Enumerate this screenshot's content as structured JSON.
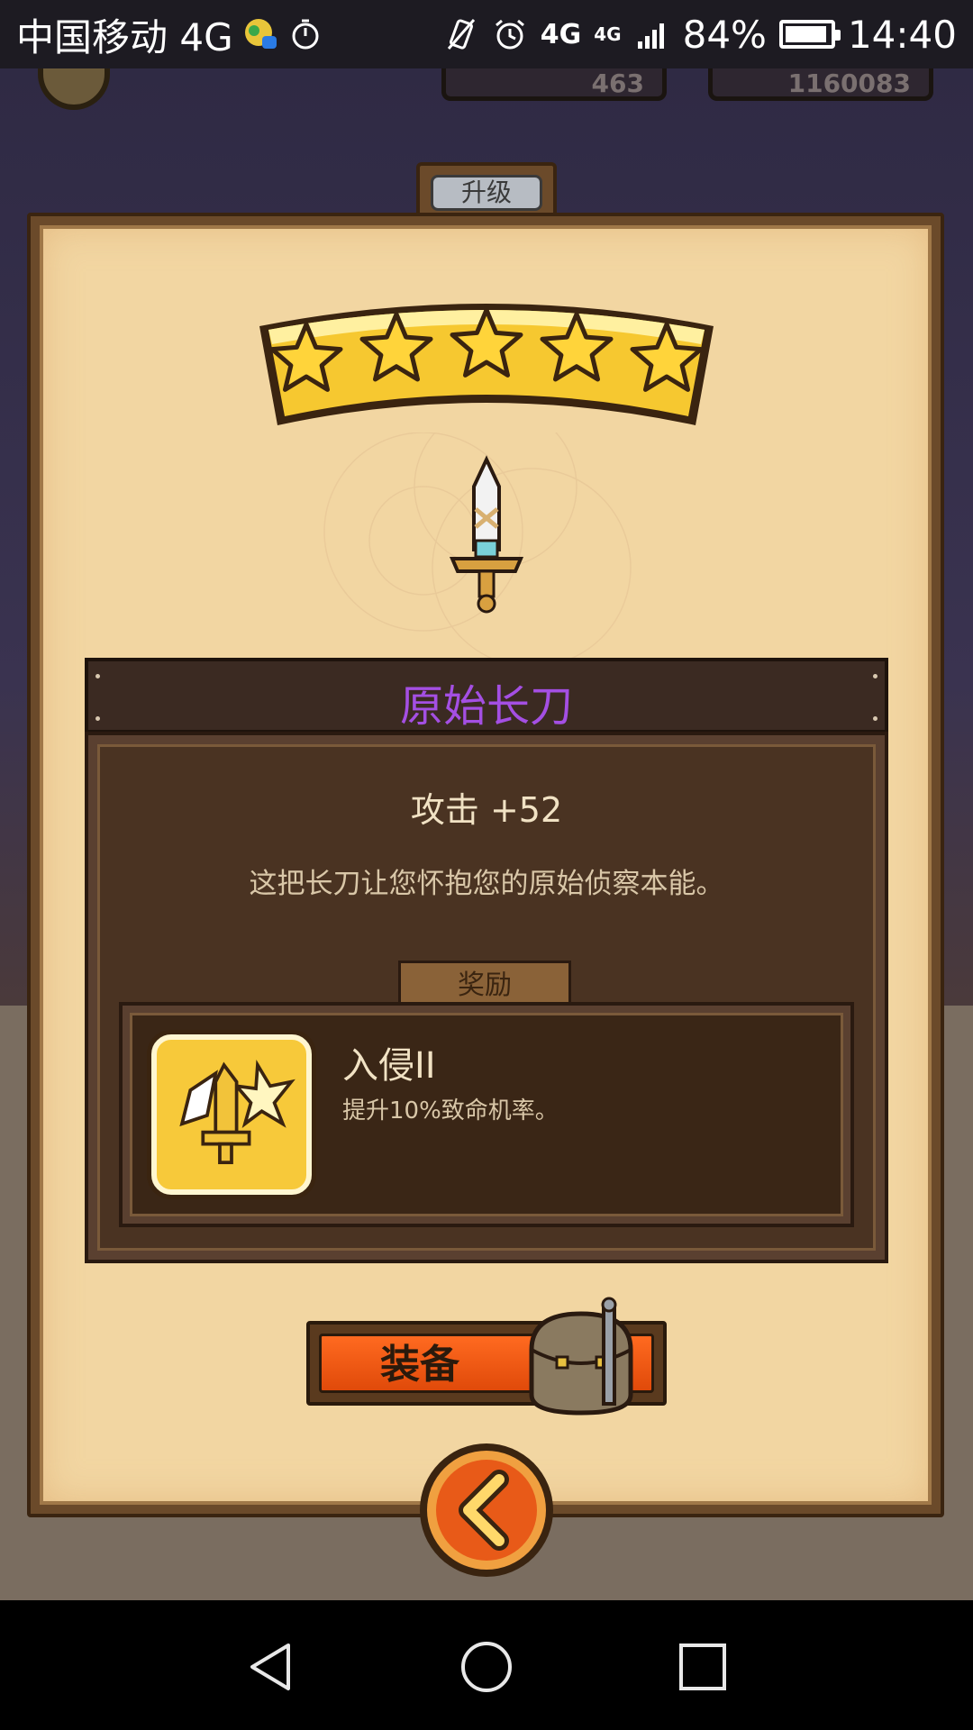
{
  "status_bar": {
    "carrier": "中国移动 4G",
    "network_type": "4G",
    "network_type_2": "4G",
    "battery": "84%",
    "battery_level": 0.84,
    "time": "14:40"
  },
  "background_hud": {
    "gems": "463",
    "coins": "1160083"
  },
  "upgrade_tab": {
    "label": "升级"
  },
  "item": {
    "stars": 5,
    "name": "原始长刀",
    "name_color": "#a44fe3",
    "stat": "攻击 +52",
    "description": "这把长刀让您怀抱您的原始侦察本能。"
  },
  "reward": {
    "tab_label": "奖励",
    "name": "入侵II",
    "description": "提升10%致命机率。"
  },
  "equip_button": {
    "label": "装备"
  },
  "colors": {
    "accent_orange": "#ff6a20",
    "panel_parchment": "#f2d6a2",
    "item_purple": "#a44fe3",
    "reward_gold": "#f7c93a"
  }
}
